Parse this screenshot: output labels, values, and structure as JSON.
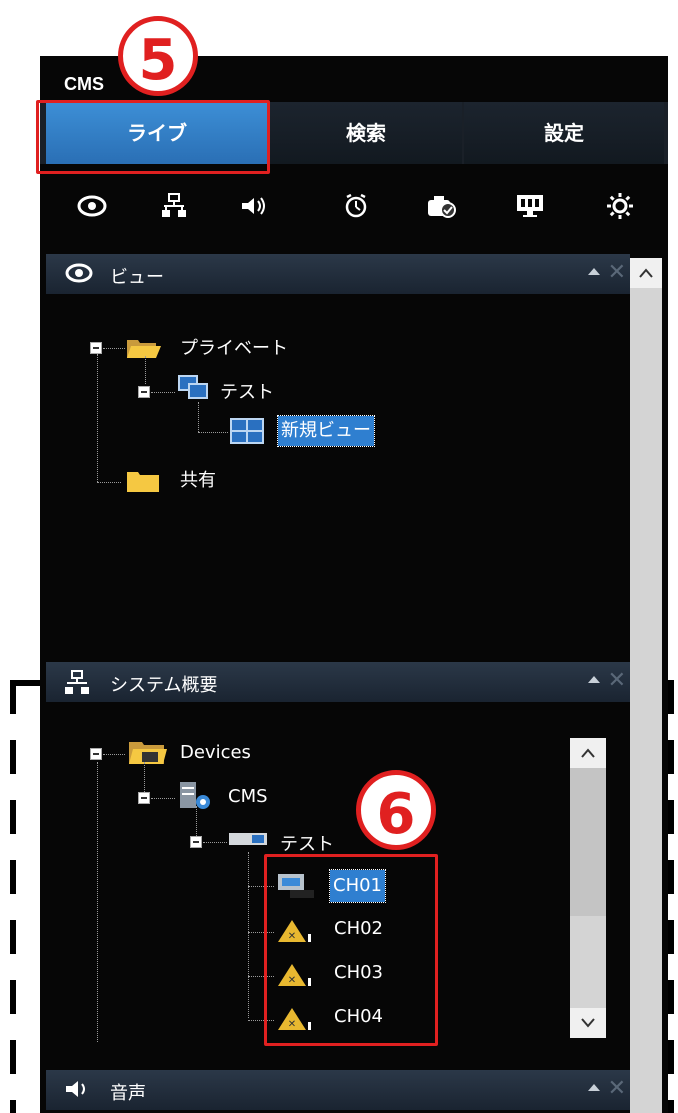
{
  "app": {
    "title": "CMS"
  },
  "tabs": [
    {
      "label": "ライブ",
      "active": true
    },
    {
      "label": "検索",
      "active": false
    },
    {
      "label": "設定",
      "active": false
    }
  ],
  "toolbar": {
    "icons": [
      "eye-icon",
      "network-icon",
      "speaker-icon",
      "alarm-clock-icon",
      "camera-check-icon",
      "monitor-icon",
      "gear-icon"
    ]
  },
  "view_panel": {
    "title": "ビュー",
    "tree": {
      "private": "プライベート",
      "test": "テスト",
      "new_view": "新規ビュー",
      "shared": "共有"
    }
  },
  "system_panel": {
    "title": "システム概要",
    "tree": {
      "devices": "Devices",
      "cms": "CMS",
      "test": "テスト",
      "channels": [
        "CH01",
        "CH02",
        "CH03",
        "CH04"
      ]
    }
  },
  "audio_panel": {
    "title": "音声"
  },
  "annotations": {
    "step5": "5",
    "step6": "6"
  },
  "colors": {
    "accent": "#2f7fd0",
    "annotation_red": "#e02020",
    "background": "#060606"
  }
}
